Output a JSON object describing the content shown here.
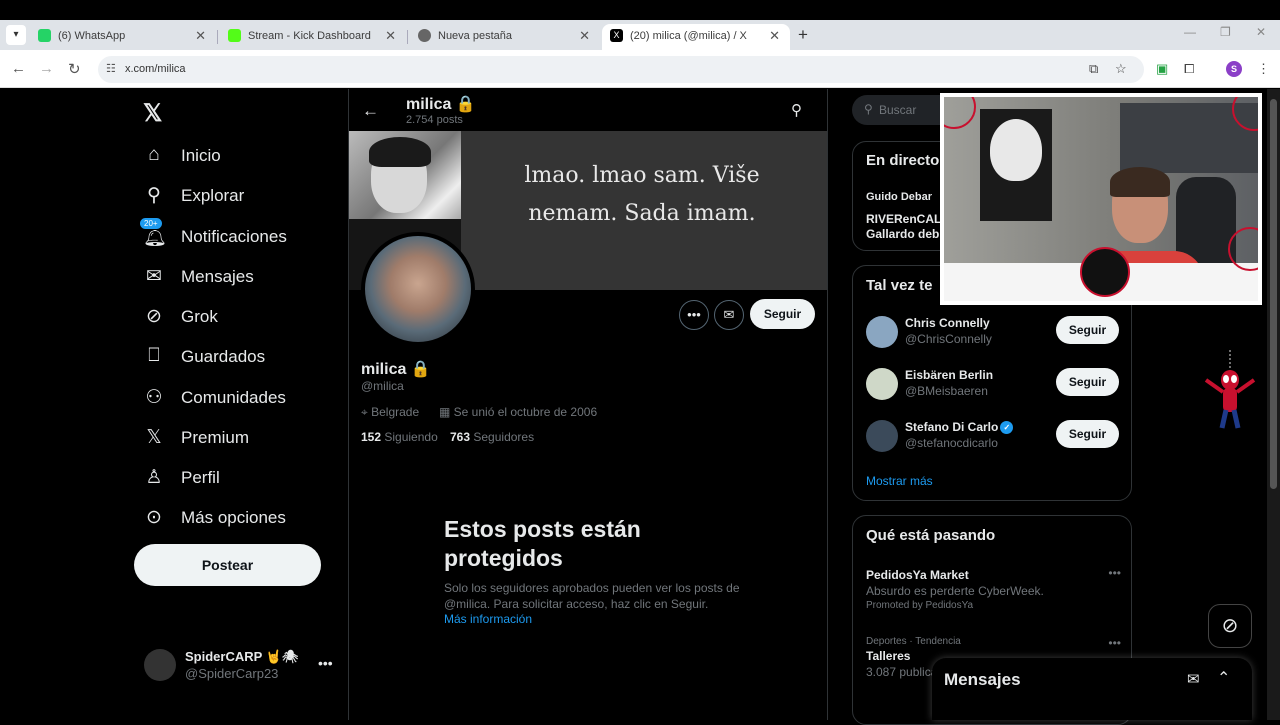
{
  "browser": {
    "tabs": [
      {
        "title": "(6) WhatsApp",
        "fav_color": "#25d366"
      },
      {
        "title": "Stream - Kick Dashboard",
        "fav_color": "#53fc18"
      },
      {
        "title": "Nueva pestaña",
        "fav_color": "#666666"
      },
      {
        "title": "(20) milica (@milica) / X",
        "fav_color": "#000000"
      }
    ],
    "url": "x.com/milica",
    "profile_initial": "S"
  },
  "sidebar": {
    "logo": "𝕏",
    "items": [
      {
        "label": "Inicio",
        "icon": "home-icon",
        "glyph": "⌂"
      },
      {
        "label": "Explorar",
        "icon": "search-icon",
        "glyph": "⚲"
      },
      {
        "label": "Notificaciones",
        "icon": "bell-icon",
        "glyph": "🔔︎",
        "badge": "20+"
      },
      {
        "label": "Mensajes",
        "icon": "mail-icon",
        "glyph": "✉"
      },
      {
        "label": "Grok",
        "icon": "grok-icon",
        "glyph": "⊘"
      },
      {
        "label": "Guardados",
        "icon": "bookmark-icon",
        "glyph": "⎕"
      },
      {
        "label": "Comunidades",
        "icon": "communities-icon",
        "glyph": "⚇"
      },
      {
        "label": "Premium",
        "icon": "x-premium-icon",
        "glyph": "𝕏"
      },
      {
        "label": "Perfil",
        "icon": "profile-icon",
        "glyph": "♙"
      },
      {
        "label": "Más opciones",
        "icon": "more-circle-icon",
        "glyph": "⊙"
      }
    ],
    "post_label": "Postear",
    "account": {
      "name": "SpiderCARP 🤘🕷",
      "handle": "@SpiderCarp23"
    }
  },
  "profile": {
    "header_name": "milica 🔒",
    "header_posts": "2.754 posts",
    "banner_quote": "lmao. lmao sam. Više nemam. Sada imam.",
    "name": "milica 🔒",
    "handle": "@milica",
    "location": "Belgrade",
    "joined": "Se unió el octubre de 2006",
    "following_count": "152",
    "following_label": "Siguiendo",
    "followers_count": "763",
    "followers_label": "Seguidores",
    "follow_label": "Seguir",
    "protected_title": "Estos posts están protegidos",
    "protected_body": "Solo los seguidores aprobados pueden ver los posts de @milica. Para solicitar acceso, haz clic en Seguir.",
    "protected_link": "Más información"
  },
  "right": {
    "search_placeholder": "Buscar",
    "live": {
      "title": "En directo",
      "host": "Guido Debar",
      "text": "RIVERenCAL Gallardo deb"
    },
    "suggest_title": "Tal vez te",
    "suggestions": [
      {
        "name": "Chris Connelly",
        "handle": "@ChrisConnelly",
        "verified": false,
        "color": "#8aa6c1"
      },
      {
        "name": "Eisbären Berlin",
        "handle": "@BMeisbaeren",
        "verified": false,
        "color": "#cfd8c8"
      },
      {
        "name": "Stefano Di Carlo",
        "handle": "@stefanocdicarlo",
        "verified": true,
        "color": "#3b4a5a"
      }
    ],
    "follow_label": "Seguir",
    "show_more": "Mostrar más",
    "trends_title": "Qué está pasando",
    "trends": [
      {
        "context": "",
        "title": "PedidosYa Market",
        "sub": "Absurdo es perderte CyberWeek.",
        "promo": "Promoted by PedidosYa"
      },
      {
        "context": "Deportes · Tendencia",
        "title": "Talleres",
        "sub": "3.087 publicac",
        "promo": ""
      }
    ]
  },
  "messages_drawer": {
    "title": "Mensajes"
  }
}
